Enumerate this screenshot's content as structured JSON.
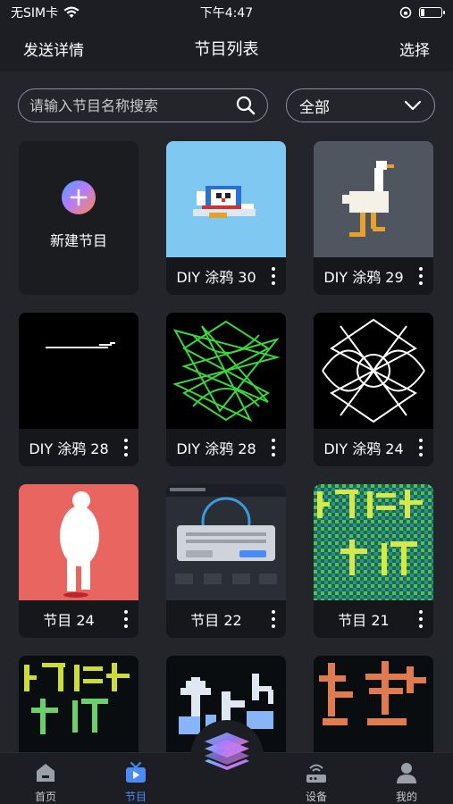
{
  "status_bar": {
    "carrier": "无SIM卡",
    "time": "下午4:47"
  },
  "nav": {
    "back_label": "发送详情",
    "title": "节目列表",
    "select_label": "选择"
  },
  "search": {
    "placeholder": "请输入节目名称搜索"
  },
  "filter": {
    "selected": "全部"
  },
  "new_program": {
    "label": "新建节目"
  },
  "programs": [
    {
      "name": "DIY 涂鸦 30",
      "thumb": "doraemon-pixel"
    },
    {
      "name": "DIY 涂鸦 29",
      "thumb": "goose-pixel"
    },
    {
      "name": "DIY 涂鸦 28",
      "thumb": "line-doodle"
    },
    {
      "name": "DIY 涂鸦 28",
      "thumb": "green-pattern"
    },
    {
      "name": "DIY 涂鸦 24",
      "thumb": "white-pattern"
    },
    {
      "name": "节目 24",
      "thumb": "walking-figure"
    },
    {
      "name": "节目 22",
      "thumb": "app-screenshot"
    },
    {
      "name": "节目 21",
      "thumb": "text-art"
    },
    {
      "name": "",
      "thumb": "text-art"
    },
    {
      "name": "",
      "thumb": "pixel-shapes"
    },
    {
      "name": "",
      "thumb": "orange-text"
    }
  ],
  "tabs": [
    {
      "label": "首页",
      "icon": "home-icon"
    },
    {
      "label": "节目",
      "icon": "tv-icon"
    },
    {
      "label": "设备",
      "icon": "router-icon"
    },
    {
      "label": "我的",
      "icon": "user-icon"
    }
  ],
  "colors": {
    "accent": "#4b8bf5",
    "background": "#23252b",
    "card": "#15171b"
  }
}
